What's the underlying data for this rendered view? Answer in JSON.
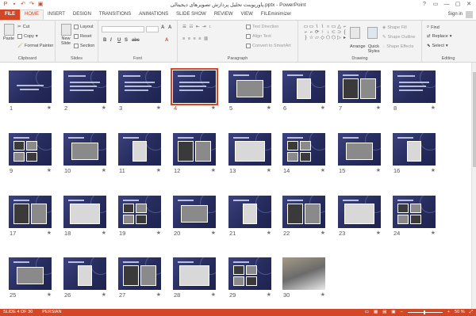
{
  "window": {
    "title": "پاورپوینت تحلیل پردازش تصویرهای دیجیتالی.pptx - PowerPoint",
    "controls": [
      "?",
      "▭",
      "—",
      "▢",
      "✕"
    ]
  },
  "tabs": {
    "file": "FILE",
    "items": [
      "HOME",
      "INSERT",
      "DESIGN",
      "TRANSITIONS",
      "ANIMATIONS",
      "SLIDE SHOW",
      "REVIEW",
      "VIEW",
      "FILEminimizer"
    ],
    "active": "HOME",
    "signin": "Sign in"
  },
  "ribbon": {
    "clipboard": {
      "paste": "Paste",
      "cut": "Cut",
      "copy": "Copy",
      "format_painter": "Format Painter",
      "label": "Clipboard"
    },
    "slides": {
      "new_slide": "New Slide",
      "layout": "Layout",
      "reset": "Reset",
      "section": "Section",
      "label": "Slides"
    },
    "font": {
      "label": "Font",
      "bold": "B",
      "italic": "I",
      "underline": "U",
      "shadow": "S",
      "strike": "abc"
    },
    "paragraph": {
      "text_direction": "Text Direction",
      "align_text": "Align Text",
      "convert_smartart": "Convert to SmartArt",
      "label": "Paragraph"
    },
    "drawing": {
      "arrange": "Arrange",
      "quick_styles": "Quick Styles",
      "shape_fill": "Shape Fill",
      "shape_outline": "Shape Outline",
      "shape_effects": "Shape Effects",
      "label": "Drawing",
      "shapes": [
        "▭",
        "▭",
        "\\",
        "\\",
        "○",
        "▭",
        "△",
        "⌐",
        "⌐",
        "⌐",
        "⟳",
        "↑",
        "↓",
        "⊂",
        "⊃",
        "{",
        "}",
        "☆",
        "▱",
        "◇",
        "⬠",
        "⬡",
        "▷",
        "▸"
      ]
    },
    "editing": {
      "find": "Find",
      "replace": "Replace",
      "select": "Select",
      "label": "Editing"
    }
  },
  "sorter": {
    "selected": 4,
    "slides": [
      {
        "n": "1",
        "kind": "title"
      },
      {
        "n": "2",
        "kind": "text"
      },
      {
        "n": "3",
        "kind": "text"
      },
      {
        "n": "4",
        "kind": "text"
      },
      {
        "n": "5",
        "kind": "pics"
      },
      {
        "n": "6",
        "kind": "pics"
      },
      {
        "n": "7",
        "kind": "pics"
      },
      {
        "n": "8",
        "kind": "text"
      },
      {
        "n": "9",
        "kind": "pics"
      },
      {
        "n": "10",
        "kind": "pics"
      },
      {
        "n": "11",
        "kind": "pics"
      },
      {
        "n": "12",
        "kind": "pics"
      },
      {
        "n": "13",
        "kind": "pics"
      },
      {
        "n": "14",
        "kind": "pics"
      },
      {
        "n": "15",
        "kind": "pics"
      },
      {
        "n": "16",
        "kind": "pics"
      },
      {
        "n": "17",
        "kind": "pics"
      },
      {
        "n": "18",
        "kind": "pics"
      },
      {
        "n": "19",
        "kind": "pics"
      },
      {
        "n": "20",
        "kind": "pics"
      },
      {
        "n": "21",
        "kind": "pics"
      },
      {
        "n": "22",
        "kind": "pics"
      },
      {
        "n": "23",
        "kind": "pics"
      },
      {
        "n": "24",
        "kind": "pics"
      },
      {
        "n": "25",
        "kind": "pics"
      },
      {
        "n": "26",
        "kind": "pics"
      },
      {
        "n": "27",
        "kind": "pics"
      },
      {
        "n": "28",
        "kind": "pics"
      },
      {
        "n": "29",
        "kind": "pics"
      },
      {
        "n": "30",
        "kind": "photo"
      }
    ],
    "star": "★"
  },
  "status": {
    "slide_info": "SLIDE 4 OF 30",
    "language": "PERSIAN",
    "zoom": "50 %"
  },
  "colors": {
    "accent": "#d24726",
    "slide_bg": "#2c3268"
  }
}
